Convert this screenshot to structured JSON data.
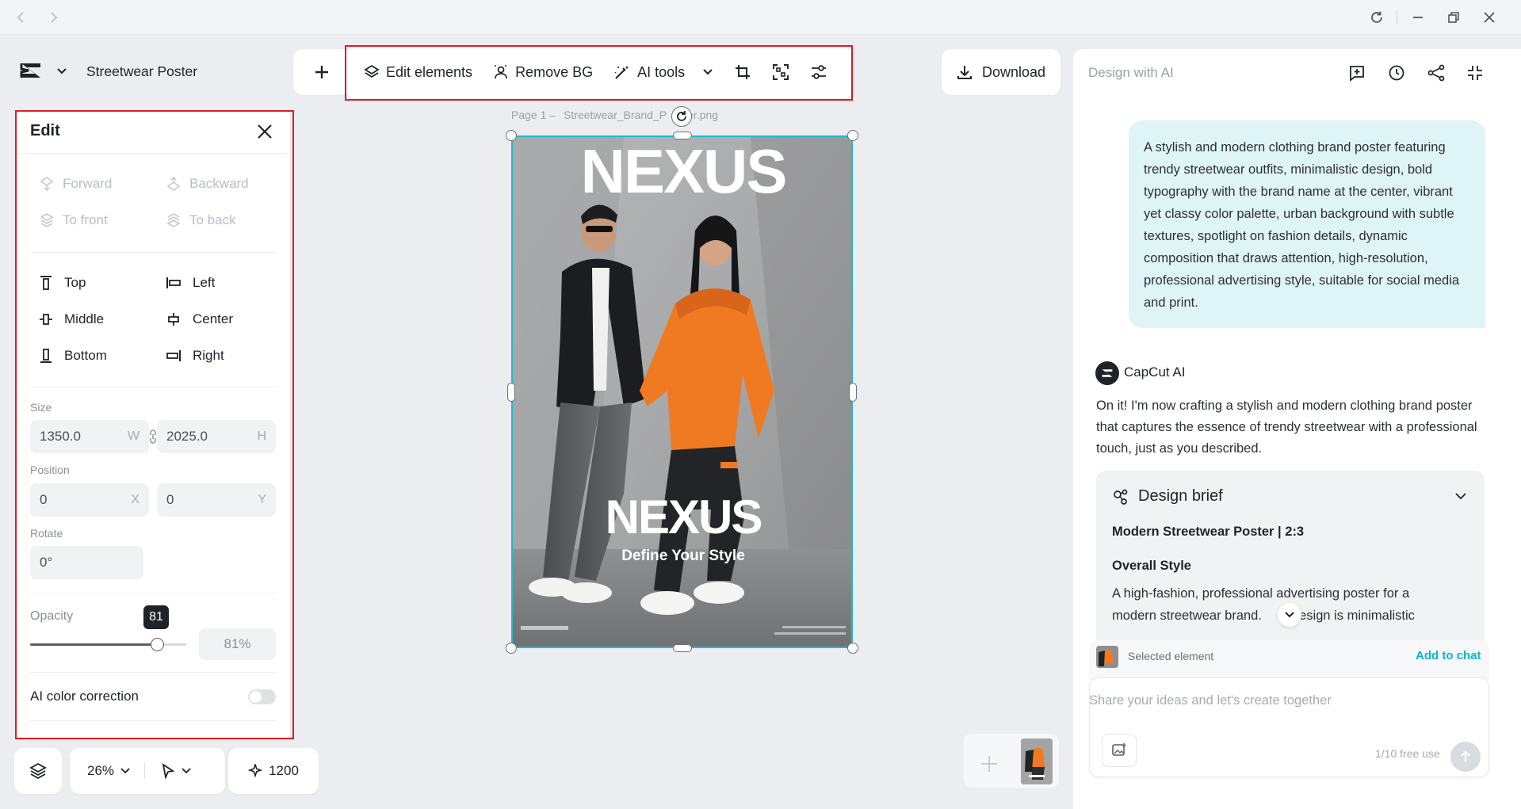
{
  "app": {
    "project_title": "Streetwear Poster"
  },
  "toolbar": {
    "edit_elements": "Edit elements",
    "remove_bg": "Remove BG",
    "ai_tools": "AI tools",
    "download": "Download"
  },
  "canvas": {
    "page_label": "Page 1 –",
    "file_name": "Streetwear_Brand_P",
    "file_ext": "er.png",
    "poster_brand_top": "NEXUS",
    "poster_brand_center": "NEXUS",
    "poster_tagline": "Define Your Style"
  },
  "edit_panel": {
    "title": "Edit",
    "layer": {
      "forward": "Forward",
      "backward": "Backward",
      "to_front": "To front",
      "to_back": "To back"
    },
    "align": {
      "top": "Top",
      "left": "Left",
      "middle": "Middle",
      "center": "Center",
      "bottom": "Bottom",
      "right": "Right"
    },
    "size_label": "Size",
    "width": "1350.0",
    "width_suffix": "W",
    "height": "2025.0",
    "height_suffix": "H",
    "position_label": "Position",
    "pos_x": "0",
    "pos_x_suffix": "X",
    "pos_y": "0",
    "pos_y_suffix": "Y",
    "rotate_label": "Rotate",
    "rotate": "0°",
    "opacity_label": "Opacity",
    "opacity_value": 81,
    "opacity_tooltip": "81",
    "opacity_field": "81%",
    "ai_color_correction": "AI color correction",
    "ai_color_correction_on": false
  },
  "bottom_bar": {
    "zoom": "26%",
    "credits": "1200"
  },
  "chat": {
    "header": "Design with AI",
    "user_message": "A stylish and modern clothing brand poster featuring trendy streetwear outfits, minimalistic design, bold typography with the brand name at the center, vibrant yet classy color palette, urban background with subtle textures, spotlight on fashion details, dynamic composition that draws attention, high-resolution, professional advertising style, suitable for social media and print.",
    "ai_name": "CapCut AI",
    "ai_message": "On it! I'm now crafting a stylish and modern clothing brand poster that captures the essence of trendy streetwear with a professional touch, just as you described.",
    "brief_title": "Design brief",
    "brief_subtitle": "Modern Streetwear Poster | 2:3",
    "brief_section": "Overall Style",
    "brief_text_1": "A high-fashion, professional advertising poster for a",
    "brief_text_2a": "modern streetwear brand.",
    "brief_text_2b": "design is minimalistic",
    "selected_element": "Selected element",
    "add_to_chat": "Add to chat",
    "input_placeholder": "Share your ideas and let's create together",
    "free_use": "1/10 free use"
  },
  "colors": {
    "accent": "#0ab6c9",
    "highlight_border": "#e01b24",
    "user_bubble": "#def4f6",
    "poster_orange": "#f07a22"
  }
}
